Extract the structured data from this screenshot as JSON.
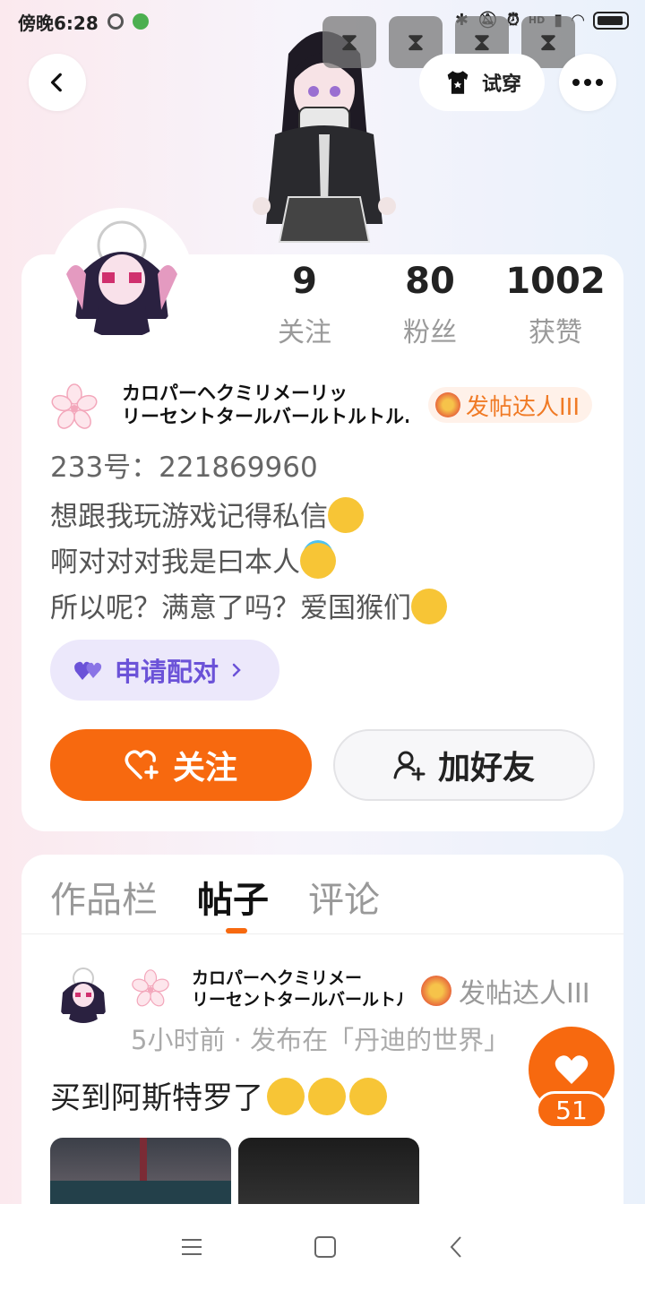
{
  "status_bar": {
    "time": "傍晚6:28",
    "network": "HD"
  },
  "header": {
    "back_icon": "chevron-left-icon",
    "try_on_label": "试穿",
    "more_icon": "more-horizontal-icon"
  },
  "stats": [
    {
      "value": "9",
      "label": "关注"
    },
    {
      "value": "80",
      "label": "粉丝"
    },
    {
      "value": "1002",
      "label": "获赞"
    }
  ],
  "profile": {
    "name_line1": "カロパーヘクミリメーリッ",
    "name_line2": "リーセントタールバールトルトル...",
    "badge": "发帖达人III",
    "id_line": "233号：221869960",
    "bio_line1": "想跟我玩游戏记得私信",
    "bio_line2": "啊对对对我是曰本人",
    "bio_line3": "所以呢？满意了吗？爱国猴们",
    "pair_label": "申请配对",
    "follow_label": "关注",
    "add_friend_label": "加好友"
  },
  "tabs": [
    {
      "label": "作品栏",
      "active": false
    },
    {
      "label": "帖子",
      "active": true
    },
    {
      "label": "评论",
      "active": false
    }
  ],
  "post": {
    "name_line1": "カロパーヘクミリメー",
    "name_line2": "リーセントタールバールトル...",
    "badge": "发帖达人III",
    "meta": "5小时前 · 发布在「丹迪的世界」",
    "text": "买到阿斯特罗了",
    "like_count": "51"
  },
  "colors": {
    "accent": "#f7690f",
    "pair_bg": "#ece8fb",
    "pair_text": "#6b52d8",
    "badge_text": "#f07a25"
  }
}
